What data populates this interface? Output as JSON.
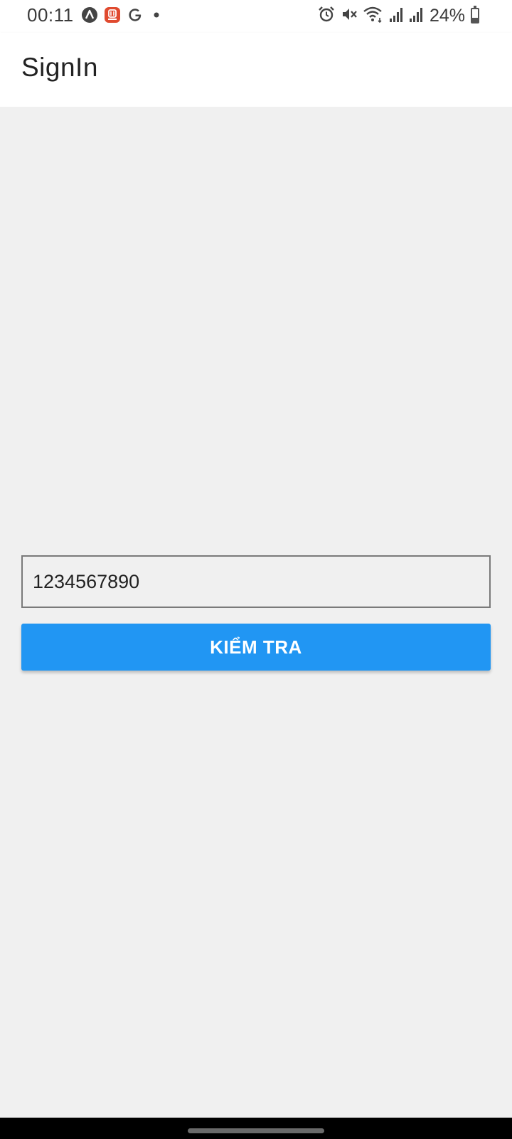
{
  "status_bar": {
    "time": "00:11",
    "battery_percent": "24%",
    "battery_level": 0.24,
    "left_icons": [
      "astra-app-icon",
      "restaurant-app-icon",
      "google-icon",
      "notification-dot-icon"
    ],
    "right_icons": [
      "alarm-icon",
      "mute-icon",
      "wifi-icon",
      "signal-icon-1",
      "signal-icon-2",
      "battery-icon"
    ]
  },
  "app_bar": {
    "title": "SignIn"
  },
  "form": {
    "phone_value": "1234567890",
    "check_button_label": "KIỂM TRA"
  },
  "colors": {
    "primary": "#2196f3",
    "background": "#f0f0f0",
    "app_bar": "#ffffff"
  }
}
